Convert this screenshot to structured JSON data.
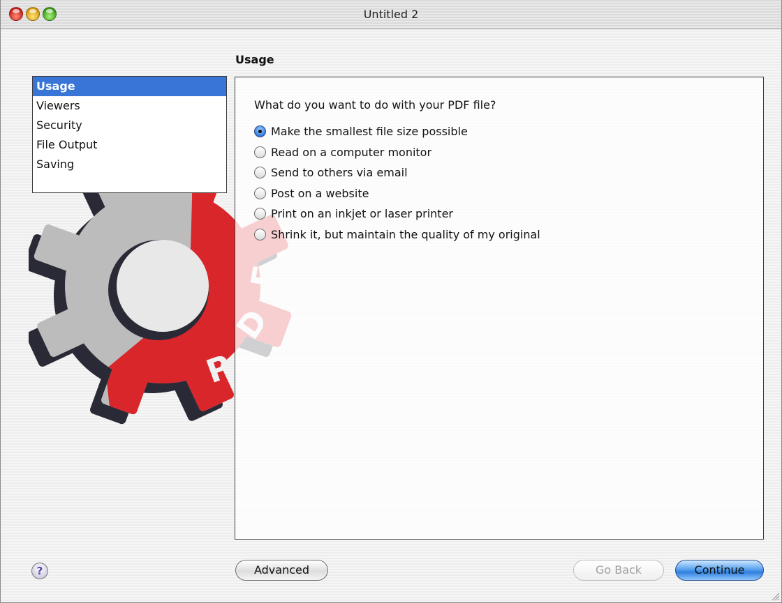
{
  "window": {
    "title": "Untitled 2"
  },
  "section_title": "Usage",
  "sidebar": {
    "items": [
      {
        "label": "Usage",
        "selected": true
      },
      {
        "label": "Viewers",
        "selected": false
      },
      {
        "label": "Security",
        "selected": false
      },
      {
        "label": "File Output",
        "selected": false
      },
      {
        "label": "Saving",
        "selected": false
      }
    ]
  },
  "main": {
    "question": "What do you want to do with your PDF file?",
    "options": [
      {
        "label": "Make the smallest file size possible",
        "selected": true
      },
      {
        "label": "Read on a computer monitor",
        "selected": false
      },
      {
        "label": "Send to others via email",
        "selected": false
      },
      {
        "label": "Post on a website",
        "selected": false
      },
      {
        "label": "Print on an inkjet or laser printer",
        "selected": false
      },
      {
        "label": "Shrink it, but maintain the quality of my original",
        "selected": false
      }
    ]
  },
  "logo": {
    "text": "PDF",
    "icon": "gear-pdf-logo",
    "colors": {
      "gear": "#bcbcbc",
      "gear_shadow": "#2a2a36",
      "red": "#d8262a"
    }
  },
  "footer": {
    "help_label": "?",
    "advanced_label": "Advanced",
    "back_label": "Go Back",
    "continue_label": "Continue"
  },
  "colors": {
    "selection": "#3875d7",
    "default_button": "#2f80de"
  }
}
